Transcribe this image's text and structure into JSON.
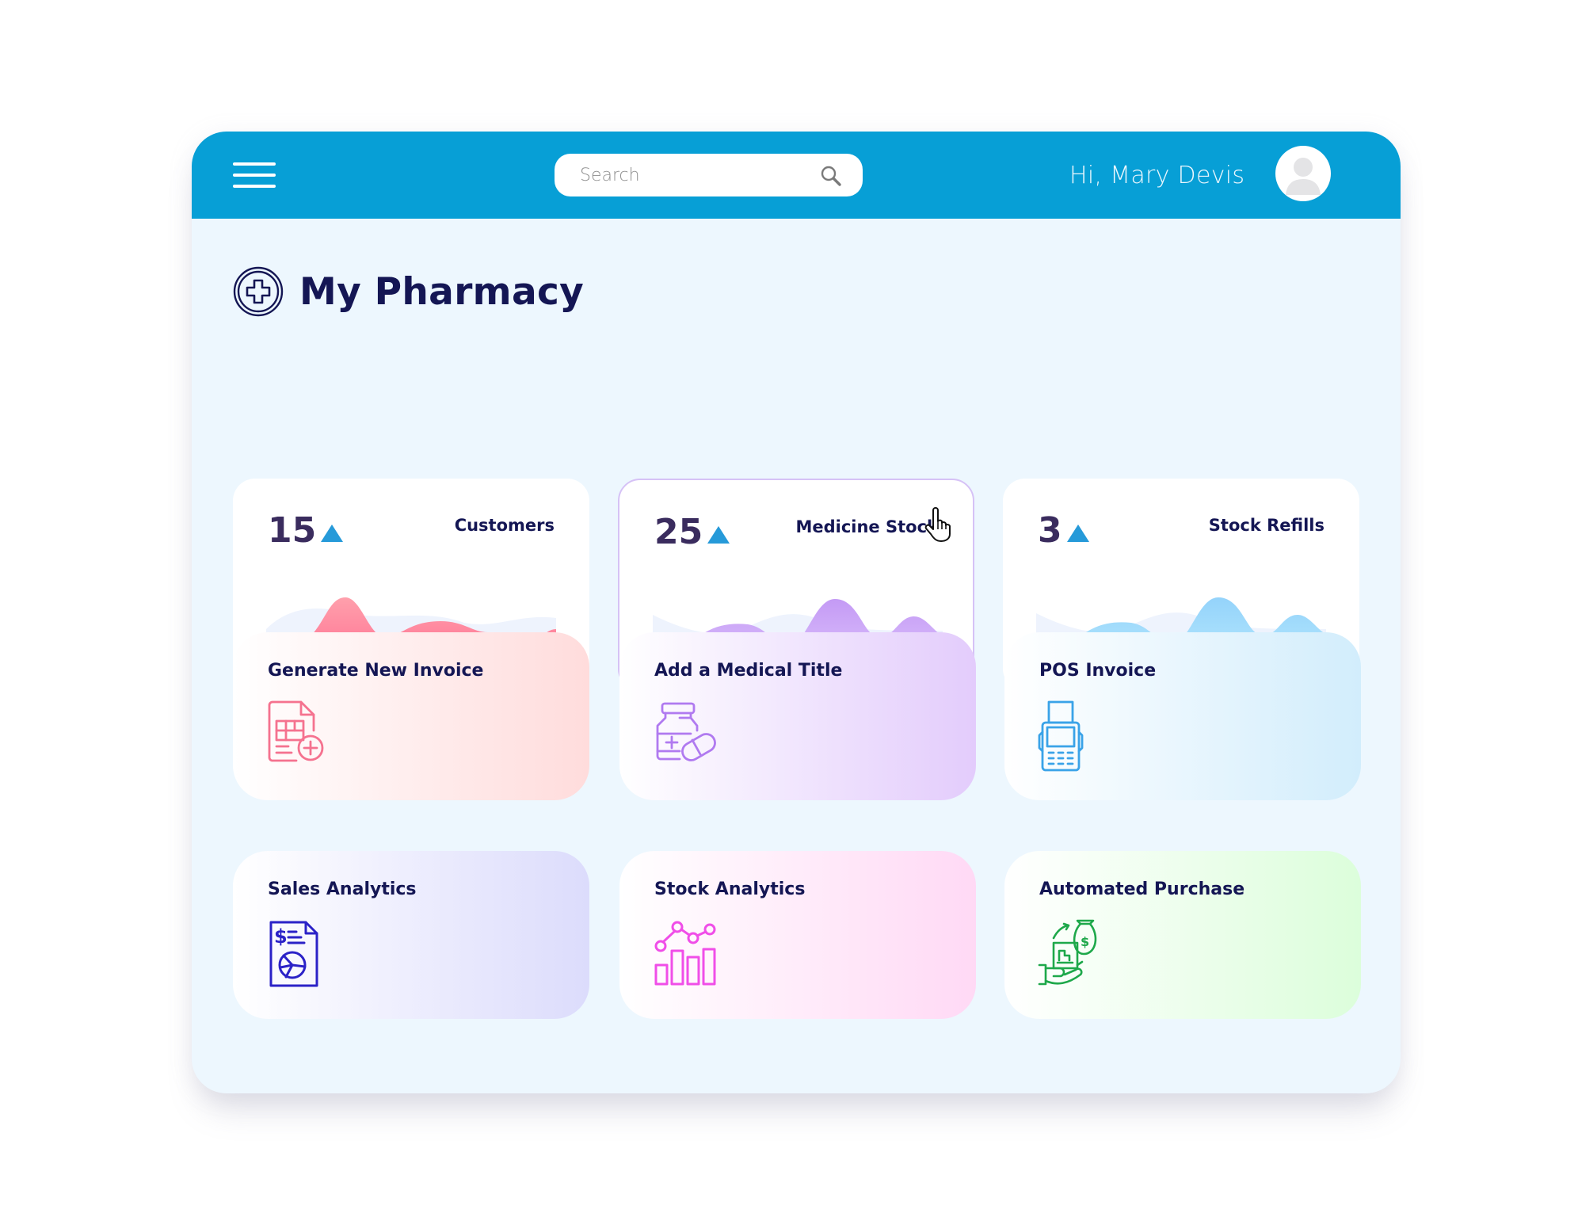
{
  "header": {
    "menu_icon": "hamburger-menu-icon",
    "search": {
      "placeholder": "Search",
      "value": "",
      "icon": "search-icon"
    },
    "greeting": "Hi, Mary Devis",
    "avatar_icon": "user-avatar-icon",
    "colors": {
      "bar": "#079fd6"
    }
  },
  "page": {
    "title": "My Pharmacy",
    "logo_icon": "medical-cross-badge-icon"
  },
  "stats": [
    {
      "value": "15",
      "trend": "up",
      "label": "Customers",
      "color": "#ff6f91",
      "active": false
    },
    {
      "value": "25",
      "trend": "up",
      "label": "Medicine Stock",
      "color": "#c49af5",
      "active": true
    },
    {
      "value": "3",
      "trend": "up",
      "label": "Stock Refills",
      "color": "#8fd3f8",
      "active": false
    }
  ],
  "actions": [
    {
      "label": "Generate New Invoice",
      "icon": "invoice-add-icon",
      "color": "#f5728f",
      "gradient_end": "#ffdcdc"
    },
    {
      "label": "Add a Medical Title",
      "icon": "medicine-bottle-pill-icon",
      "color": "#b07af0",
      "gradient_end": "#e3ccfc"
    },
    {
      "label": "POS Invoice",
      "icon": "pos-terminal-icon",
      "color": "#3aa3e8",
      "gradient_end": "#d2edfc"
    },
    {
      "label": "Sales Analytics",
      "icon": "sales-report-icon",
      "color": "#2b22c7",
      "gradient_end": "#dcdcfc"
    },
    {
      "label": "Stock Analytics",
      "icon": "bar-line-chart-icon",
      "color": "#f04ee8",
      "gradient_end": "#ffd9f5"
    },
    {
      "label": "Automated Purchase",
      "icon": "money-hand-purchase-icon",
      "color": "#1ea84a",
      "gradient_end": "#dcfedb"
    }
  ],
  "cursor_icon": "hand-pointer-icon"
}
